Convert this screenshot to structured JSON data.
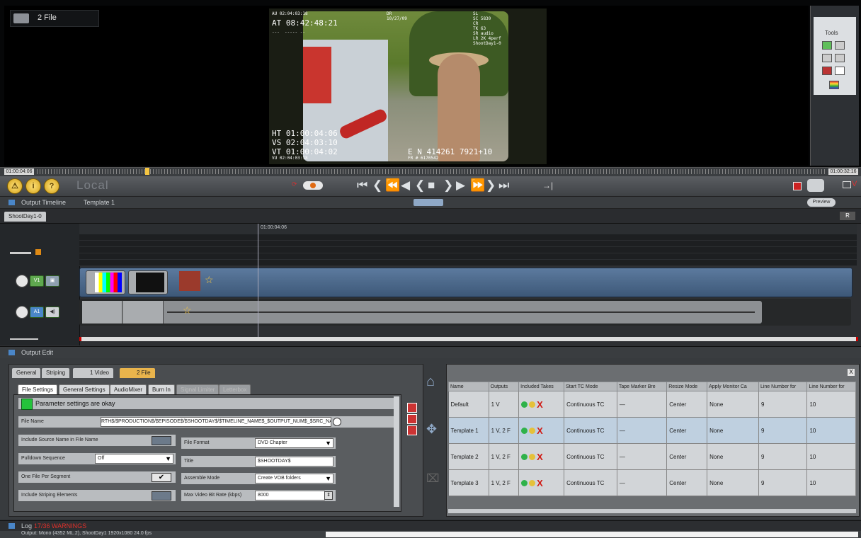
{
  "viewer": {
    "file_label": "2 File",
    "overlay": {
      "top_left_small": "AU 02:04:03:18",
      "at": "AT 08:42:48:21",
      "top_left_dash": "---  ----- --",
      "date_label": "DR",
      "date": "10/27/09",
      "right_block": "SL\nSC 5830\nCR\nTK 63\nSR audio\nLR 2K 4perf\nShootDay1-0",
      "ht": "HT 01:00:04:06",
      "vs": "VS 02:04:03:10",
      "vt": "VT 01:00:04:02",
      "vu": "VU 02:04:03:18",
      "en": "E N 414261 7921+10",
      "fr": "FR # 6170542"
    },
    "tools_label": "Tools"
  },
  "scrub": {
    "tc_left": "01:00:04:06",
    "tc_right": "01:00:32:16"
  },
  "transport": {
    "local": "Local",
    "buttons": [
      "⏮",
      "❮",
      "⏪",
      "◀",
      "❮",
      "■",
      "❯",
      "▶",
      "⏩",
      "❯",
      "⏭"
    ]
  },
  "output_timeline": {
    "title": "Output Timeline",
    "template": "Template 1",
    "preview": "Preview",
    "tab": "ShootDay1-0",
    "r": "R",
    "ruler_tc": "01:00:04:06"
  },
  "output_edit": {
    "title": "Output Edit",
    "top_tabs": [
      "General",
      "Striping",
      "1 Video",
      "2 File"
    ],
    "sub_tabs": [
      "File Settings",
      "General Settings",
      "AudioMixer",
      "Burn In",
      "Signal Limiter",
      "Letterbox"
    ],
    "status": "Parameter settings are okay",
    "file_name_label": "File Name",
    "file_name_value": "RTH$/$PRODUCTION$/$EPISODE$/$SHOOTDAY$/$TIMELINE_NAME$_$OUTPUT_NUM$_$SRC_NAME$",
    "left_rows": [
      {
        "label": "Include Source Name in File Name",
        "value": ""
      },
      {
        "label": "Pulldown Sequence",
        "value": "Off"
      },
      {
        "label": "One File Per Segment",
        "value": "✔"
      },
      {
        "label": "Include Striping Elements",
        "value": ""
      }
    ],
    "right_rows": [
      {
        "label": "File Format",
        "value": "DVD Chapter"
      },
      {
        "label": "Title",
        "value": "$SHOOTDAY$"
      },
      {
        "label": "Assemble Mode",
        "value": "Create VOB folders"
      },
      {
        "label": "Max Video Bit Rate (kbps)",
        "value": "8000"
      }
    ]
  },
  "outputs_table": {
    "headers": [
      "Name",
      "Outputs",
      "Included Takes",
      "Start TC Mode",
      "Tape Marker Bre",
      "Resize Mode",
      "Apply Monitor Ca",
      "Line Number for",
      "Line Number for"
    ],
    "rows": [
      {
        "name": "Default",
        "outputs": "1 V",
        "tc": "Continuous TC",
        "tape": "—",
        "resize": "Center",
        "monitor": "None",
        "ln1": "9",
        "ln2": "10"
      },
      {
        "name": "Template 1",
        "outputs": "1 V, 2 F",
        "tc": "Continuous TC",
        "tape": "—",
        "resize": "Center",
        "monitor": "None",
        "ln1": "9",
        "ln2": "10"
      },
      {
        "name": "Template 2",
        "outputs": "1 V, 2 F",
        "tc": "Continuous TC",
        "tape": "—",
        "resize": "Center",
        "monitor": "None",
        "ln1": "9",
        "ln2": "10"
      },
      {
        "name": "Template 3",
        "outputs": "1 V, 2 F",
        "tc": "Continuous TC",
        "tape": "—",
        "resize": "Center",
        "monitor": "None",
        "ln1": "9",
        "ln2": "10"
      }
    ]
  },
  "log": {
    "label": "Log",
    "warnings": "17/36 WARNINGS"
  },
  "status": {
    "text": "Output: Mono (4352 ML.2), ShootDay1 1920x1080 24.0 fps"
  },
  "colors": {
    "accent_blue": "#4a86c8",
    "ok_green": "#24c33b",
    "warn_red": "#e0302a"
  }
}
